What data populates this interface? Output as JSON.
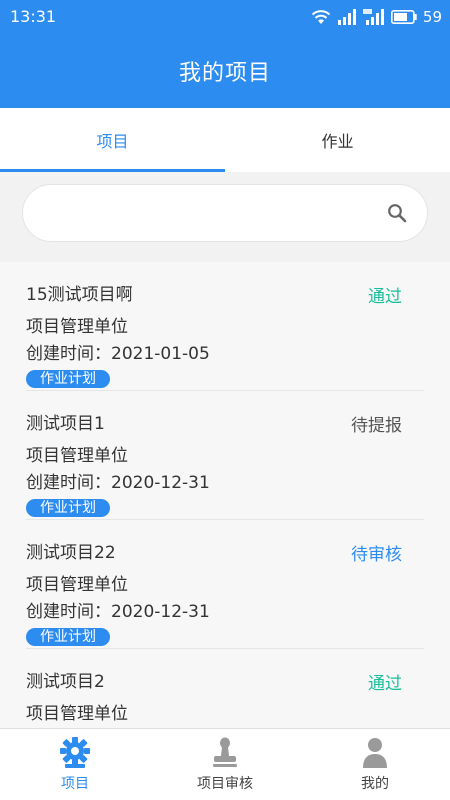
{
  "status_bar": {
    "time": "13:31",
    "battery": "59"
  },
  "header": {
    "title": "我的项目"
  },
  "tabs": [
    {
      "label": "项目",
      "active": true
    },
    {
      "label": "作业",
      "active": false
    }
  ],
  "search": {
    "placeholder": "",
    "value": ""
  },
  "projects": [
    {
      "name": "15测试项目啊",
      "unit": "项目管理单位",
      "date": "创建时间：2021-01-05",
      "status": "通过",
      "status_color": "#19be9b",
      "plan_label": "作业计划"
    },
    {
      "name": "测试项目1",
      "unit": "项目管理单位",
      "date": "创建时间：2020-12-31",
      "status": "待提报",
      "status_color": "#555555",
      "plan_label": "作业计划"
    },
    {
      "name": "测试项目22",
      "unit": "项目管理单位",
      "date": "创建时间：2020-12-31",
      "status": "待审核",
      "status_color": "#2d8cf0",
      "plan_label": "作业计划"
    },
    {
      "name": "测试项目2",
      "unit": "项目管理单位",
      "date": "",
      "status": "通过",
      "status_color": "#19be9b",
      "plan_label": ""
    }
  ],
  "bottom_nav": [
    {
      "label": "项目",
      "icon": "gear-icon",
      "active": true
    },
    {
      "label": "项目审核",
      "icon": "stamp-icon",
      "active": false
    },
    {
      "label": "我的",
      "icon": "person-icon",
      "active": false
    }
  ],
  "colors": {
    "primary": "#2d8cf0",
    "approved": "#19be9b",
    "pending_review": "#2d8cf0",
    "pending_submit": "#555555"
  }
}
